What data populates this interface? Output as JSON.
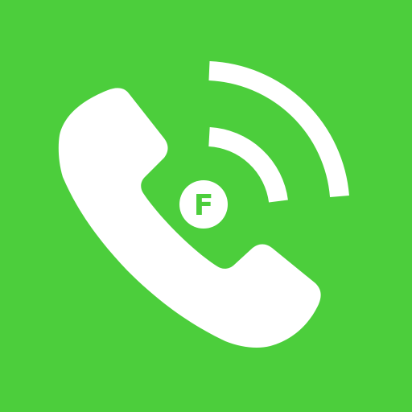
{
  "icon": {
    "name": "phone-call-app-icon",
    "background_color": "#4cce3c",
    "foreground_color": "#ffffff",
    "glyphs": [
      "phone-handset-icon",
      "signal-waves-icon",
      "letter-badge"
    ],
    "badge": {
      "letter": "F",
      "letter_color": "#4cce3c",
      "circle_color": "#ffffff"
    }
  }
}
